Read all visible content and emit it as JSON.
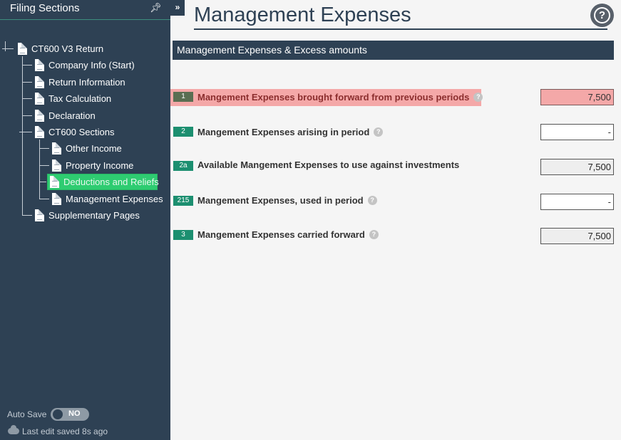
{
  "sidebar": {
    "title": "Filing Sections",
    "collapse_label": "»",
    "tree": [
      {
        "label": "CT600 V3 Return"
      },
      {
        "label": "Company Info (Start)"
      },
      {
        "label": "Return Information"
      },
      {
        "label": "Tax Calculation"
      },
      {
        "label": "Declaration"
      },
      {
        "label": "CT600 Sections"
      },
      {
        "label": "Other Income"
      },
      {
        "label": "Property Income"
      },
      {
        "label": "Deductions and Reliefs"
      },
      {
        "label": "Management Expenses"
      },
      {
        "label": "Supplementary Pages"
      }
    ],
    "selected_item": "Deductions and Reliefs",
    "autosave_label": "Auto Save",
    "autosave_state": "NO",
    "last_edit": "Last edit saved 8s ago"
  },
  "main": {
    "page_title": "Management Expenses",
    "help_icon": "?",
    "section_title": "Management Expenses & Excess amounts",
    "rows": [
      {
        "box": "1",
        "label": "Mangement Expenses brought forward from previous periods",
        "help": "?",
        "value": "7,500",
        "state": "error"
      },
      {
        "box": "2",
        "label": "Mangement Expenses arising in period",
        "help": "?",
        "value": "-",
        "state": "editable"
      },
      {
        "box": "2a",
        "label": "Available Mangement Expenses to use against investments",
        "help": "",
        "value": "7,500",
        "state": "readonly"
      },
      {
        "box": "215",
        "label": "Mangement Expenses, used in period",
        "help": "?",
        "value": "-",
        "state": "editable"
      },
      {
        "box": "3",
        "label": "Mangement Expenses carried forward",
        "help": "?",
        "value": "7,500",
        "state": "readonly"
      }
    ]
  },
  "colors": {
    "sidebar_bg": "#2e4154",
    "selected": "#2ecc71",
    "badge": "#1c8f70",
    "error_bg": "#f4a8a8"
  }
}
